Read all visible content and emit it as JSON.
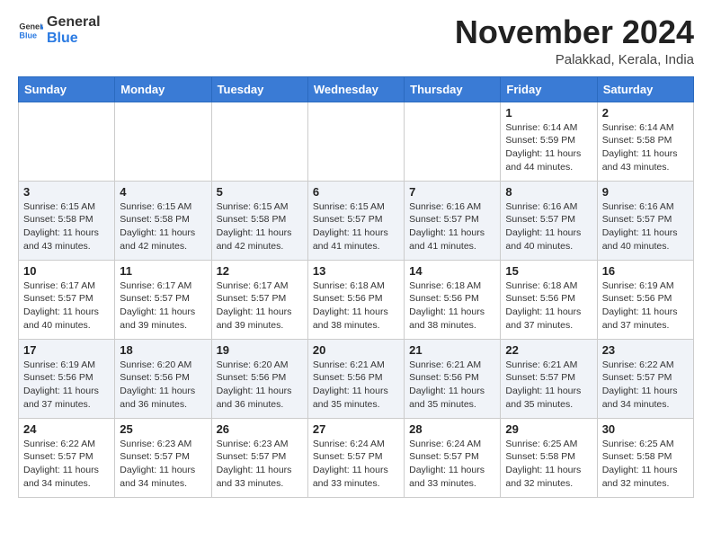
{
  "header": {
    "logo_general": "General",
    "logo_blue": "Blue",
    "month_title": "November 2024",
    "location": "Palakkad, Kerala, India"
  },
  "weekdays": [
    "Sunday",
    "Monday",
    "Tuesday",
    "Wednesday",
    "Thursday",
    "Friday",
    "Saturday"
  ],
  "weeks": [
    [
      {
        "day": "",
        "info": ""
      },
      {
        "day": "",
        "info": ""
      },
      {
        "day": "",
        "info": ""
      },
      {
        "day": "",
        "info": ""
      },
      {
        "day": "",
        "info": ""
      },
      {
        "day": "1",
        "info": "Sunrise: 6:14 AM\nSunset: 5:59 PM\nDaylight: 11 hours\nand 44 minutes."
      },
      {
        "day": "2",
        "info": "Sunrise: 6:14 AM\nSunset: 5:58 PM\nDaylight: 11 hours\nand 43 minutes."
      }
    ],
    [
      {
        "day": "3",
        "info": "Sunrise: 6:15 AM\nSunset: 5:58 PM\nDaylight: 11 hours\nand 43 minutes."
      },
      {
        "day": "4",
        "info": "Sunrise: 6:15 AM\nSunset: 5:58 PM\nDaylight: 11 hours\nand 42 minutes."
      },
      {
        "day": "5",
        "info": "Sunrise: 6:15 AM\nSunset: 5:58 PM\nDaylight: 11 hours\nand 42 minutes."
      },
      {
        "day": "6",
        "info": "Sunrise: 6:15 AM\nSunset: 5:57 PM\nDaylight: 11 hours\nand 41 minutes."
      },
      {
        "day": "7",
        "info": "Sunrise: 6:16 AM\nSunset: 5:57 PM\nDaylight: 11 hours\nand 41 minutes."
      },
      {
        "day": "8",
        "info": "Sunrise: 6:16 AM\nSunset: 5:57 PM\nDaylight: 11 hours\nand 40 minutes."
      },
      {
        "day": "9",
        "info": "Sunrise: 6:16 AM\nSunset: 5:57 PM\nDaylight: 11 hours\nand 40 minutes."
      }
    ],
    [
      {
        "day": "10",
        "info": "Sunrise: 6:17 AM\nSunset: 5:57 PM\nDaylight: 11 hours\nand 40 minutes."
      },
      {
        "day": "11",
        "info": "Sunrise: 6:17 AM\nSunset: 5:57 PM\nDaylight: 11 hours\nand 39 minutes."
      },
      {
        "day": "12",
        "info": "Sunrise: 6:17 AM\nSunset: 5:57 PM\nDaylight: 11 hours\nand 39 minutes."
      },
      {
        "day": "13",
        "info": "Sunrise: 6:18 AM\nSunset: 5:56 PM\nDaylight: 11 hours\nand 38 minutes."
      },
      {
        "day": "14",
        "info": "Sunrise: 6:18 AM\nSunset: 5:56 PM\nDaylight: 11 hours\nand 38 minutes."
      },
      {
        "day": "15",
        "info": "Sunrise: 6:18 AM\nSunset: 5:56 PM\nDaylight: 11 hours\nand 37 minutes."
      },
      {
        "day": "16",
        "info": "Sunrise: 6:19 AM\nSunset: 5:56 PM\nDaylight: 11 hours\nand 37 minutes."
      }
    ],
    [
      {
        "day": "17",
        "info": "Sunrise: 6:19 AM\nSunset: 5:56 PM\nDaylight: 11 hours\nand 37 minutes."
      },
      {
        "day": "18",
        "info": "Sunrise: 6:20 AM\nSunset: 5:56 PM\nDaylight: 11 hours\nand 36 minutes."
      },
      {
        "day": "19",
        "info": "Sunrise: 6:20 AM\nSunset: 5:56 PM\nDaylight: 11 hours\nand 36 minutes."
      },
      {
        "day": "20",
        "info": "Sunrise: 6:21 AM\nSunset: 5:56 PM\nDaylight: 11 hours\nand 35 minutes."
      },
      {
        "day": "21",
        "info": "Sunrise: 6:21 AM\nSunset: 5:56 PM\nDaylight: 11 hours\nand 35 minutes."
      },
      {
        "day": "22",
        "info": "Sunrise: 6:21 AM\nSunset: 5:57 PM\nDaylight: 11 hours\nand 35 minutes."
      },
      {
        "day": "23",
        "info": "Sunrise: 6:22 AM\nSunset: 5:57 PM\nDaylight: 11 hours\nand 34 minutes."
      }
    ],
    [
      {
        "day": "24",
        "info": "Sunrise: 6:22 AM\nSunset: 5:57 PM\nDaylight: 11 hours\nand 34 minutes."
      },
      {
        "day": "25",
        "info": "Sunrise: 6:23 AM\nSunset: 5:57 PM\nDaylight: 11 hours\nand 34 minutes."
      },
      {
        "day": "26",
        "info": "Sunrise: 6:23 AM\nSunset: 5:57 PM\nDaylight: 11 hours\nand 33 minutes."
      },
      {
        "day": "27",
        "info": "Sunrise: 6:24 AM\nSunset: 5:57 PM\nDaylight: 11 hours\nand 33 minutes."
      },
      {
        "day": "28",
        "info": "Sunrise: 6:24 AM\nSunset: 5:57 PM\nDaylight: 11 hours\nand 33 minutes."
      },
      {
        "day": "29",
        "info": "Sunrise: 6:25 AM\nSunset: 5:58 PM\nDaylight: 11 hours\nand 32 minutes."
      },
      {
        "day": "30",
        "info": "Sunrise: 6:25 AM\nSunset: 5:58 PM\nDaylight: 11 hours\nand 32 minutes."
      }
    ]
  ]
}
